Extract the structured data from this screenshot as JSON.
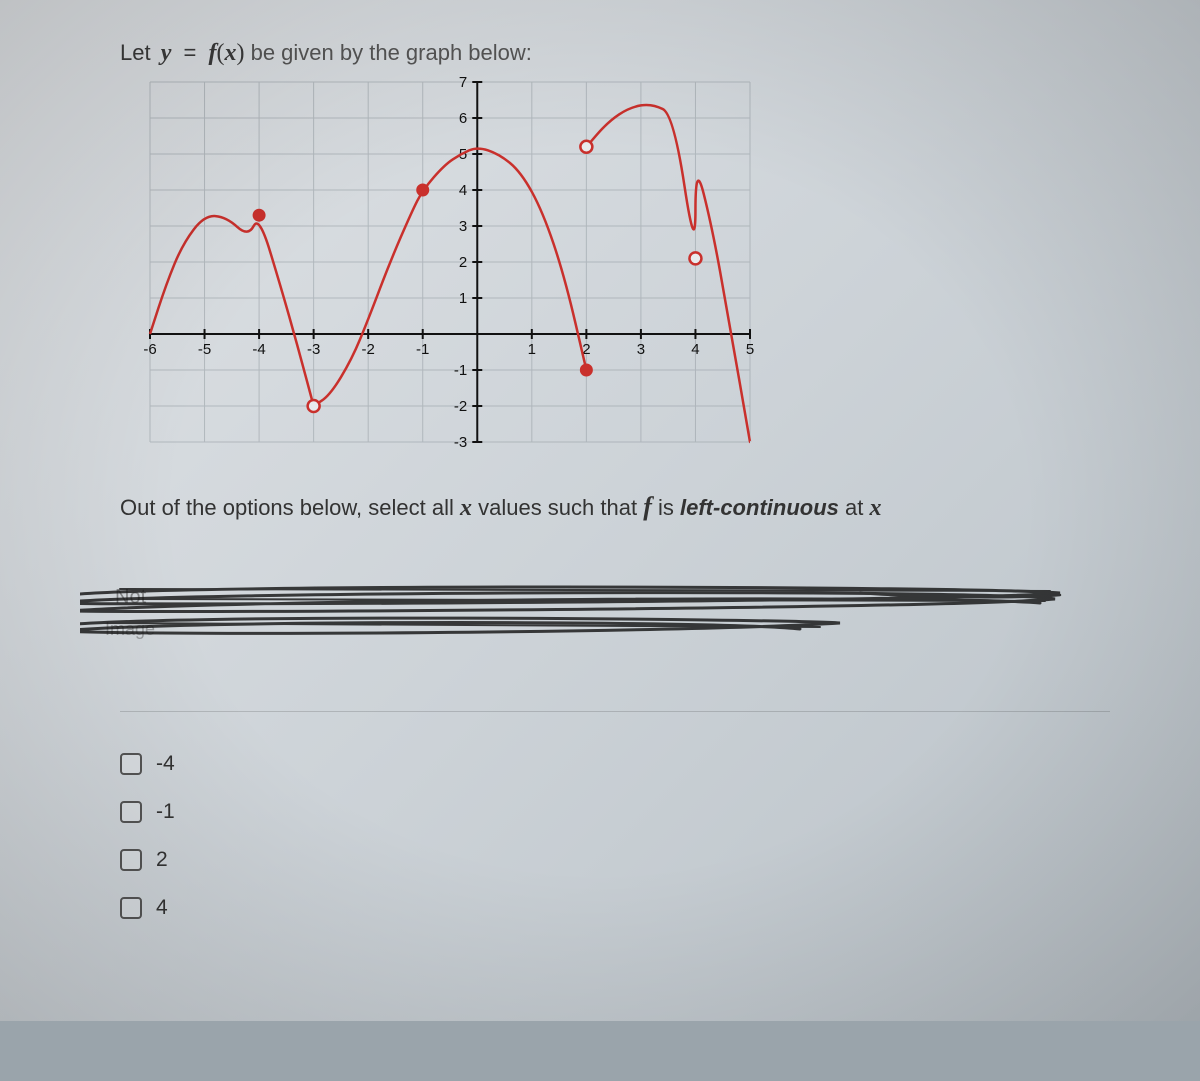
{
  "prompt": {
    "let": "Let ",
    "y": "y",
    "eq": "=",
    "f": "f",
    "lpar": "(",
    "x": "x",
    "rpar": ")",
    "rest": " be given by the graph below:"
  },
  "question": {
    "part1": "Out of the options below, select all ",
    "xvar": "x",
    "part2": " values such that ",
    "fvar": "f",
    "part3": " is ",
    "term": "left-continuous",
    "part4": " at ",
    "xvar2": "x"
  },
  "scribble": {
    "note": "Not",
    "image": "Image"
  },
  "options": [
    {
      "label": "-4"
    },
    {
      "label": "-1"
    },
    {
      "label": "2"
    },
    {
      "label": "4"
    }
  ],
  "chart_data": {
    "type": "line",
    "title": "",
    "xlabel": "",
    "ylabel": "",
    "xlim": [
      -6,
      5
    ],
    "ylim": [
      -3,
      7
    ],
    "xticks": [
      -6,
      -5,
      -4,
      -3,
      -2,
      -1,
      1,
      2,
      3,
      4,
      5
    ],
    "yticks": [
      -3,
      -2,
      -1,
      1,
      2,
      3,
      4,
      5,
      6,
      7
    ],
    "grid": true,
    "curve_segments": [
      {
        "comment": "left hump",
        "points": [
          [
            -6,
            0
          ],
          [
            -5.7,
            1.4
          ],
          [
            -5.4,
            2.5
          ],
          [
            -5,
            3.3
          ],
          [
            -4.6,
            3.25
          ],
          [
            -4.2,
            2.7
          ],
          [
            -4,
            3.3
          ],
          [
            -3.6,
            1.3
          ],
          [
            -3.3,
            -0.3
          ],
          [
            -3,
            -2
          ]
        ]
      },
      {
        "comment": "middle arch",
        "points": [
          [
            -3,
            -2
          ],
          [
            -2.7,
            -1.7
          ],
          [
            -2.3,
            -0.7
          ],
          [
            -2,
            0.4
          ],
          [
            -1.6,
            2.0
          ],
          [
            -1.2,
            3.4
          ],
          [
            -1,
            4
          ],
          [
            -0.6,
            4.7
          ],
          [
            -0.3,
            5.0
          ],
          [
            0,
            5.2
          ],
          [
            0.4,
            5.0
          ],
          [
            0.8,
            4.5
          ],
          [
            1.2,
            3.4
          ],
          [
            1.6,
            1.6
          ],
          [
            2,
            -1
          ]
        ]
      },
      {
        "comment": "right hump",
        "points": [
          [
            2,
            5.2
          ],
          [
            2.4,
            5.9
          ],
          [
            2.8,
            6.3
          ],
          [
            3.2,
            6.4
          ],
          [
            3.6,
            6.1
          ],
          [
            4,
            2.1
          ],
          [
            4,
            4.8
          ],
          [
            4.3,
            3.0
          ],
          [
            4.6,
            0.5
          ],
          [
            5,
            -3
          ]
        ]
      }
    ],
    "points_closed": [
      {
        "x": -4,
        "y": 3.3
      },
      {
        "x": -1,
        "y": 4
      },
      {
        "x": 2,
        "y": -1
      }
    ],
    "points_open": [
      {
        "x": -3,
        "y": -2
      },
      {
        "x": 2,
        "y": 5.2
      },
      {
        "x": 4,
        "y": 2.1
      }
    ]
  }
}
